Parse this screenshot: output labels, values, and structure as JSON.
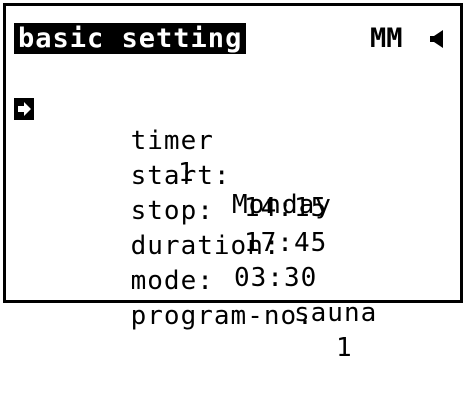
{
  "header": {
    "title": "basic setting",
    "unit": "MM",
    "indicator_icon": "speaker-icon"
  },
  "cursor_icon": "selection-arrow-icon",
  "menu": {
    "rows": [
      {
        "label": "timer",
        "value": "1",
        "value2": "Monday"
      },
      {
        "label": "start:",
        "value": "14:15"
      },
      {
        "label": "stop:",
        "value": "17:45"
      },
      {
        "label": "duration:",
        "value": "03:30"
      },
      {
        "label": "mode:",
        "value": "sauna"
      },
      {
        "label": "program-no.",
        "value": "1"
      }
    ]
  },
  "colors": {
    "foreground": "#000000",
    "background": "#ffffff"
  }
}
